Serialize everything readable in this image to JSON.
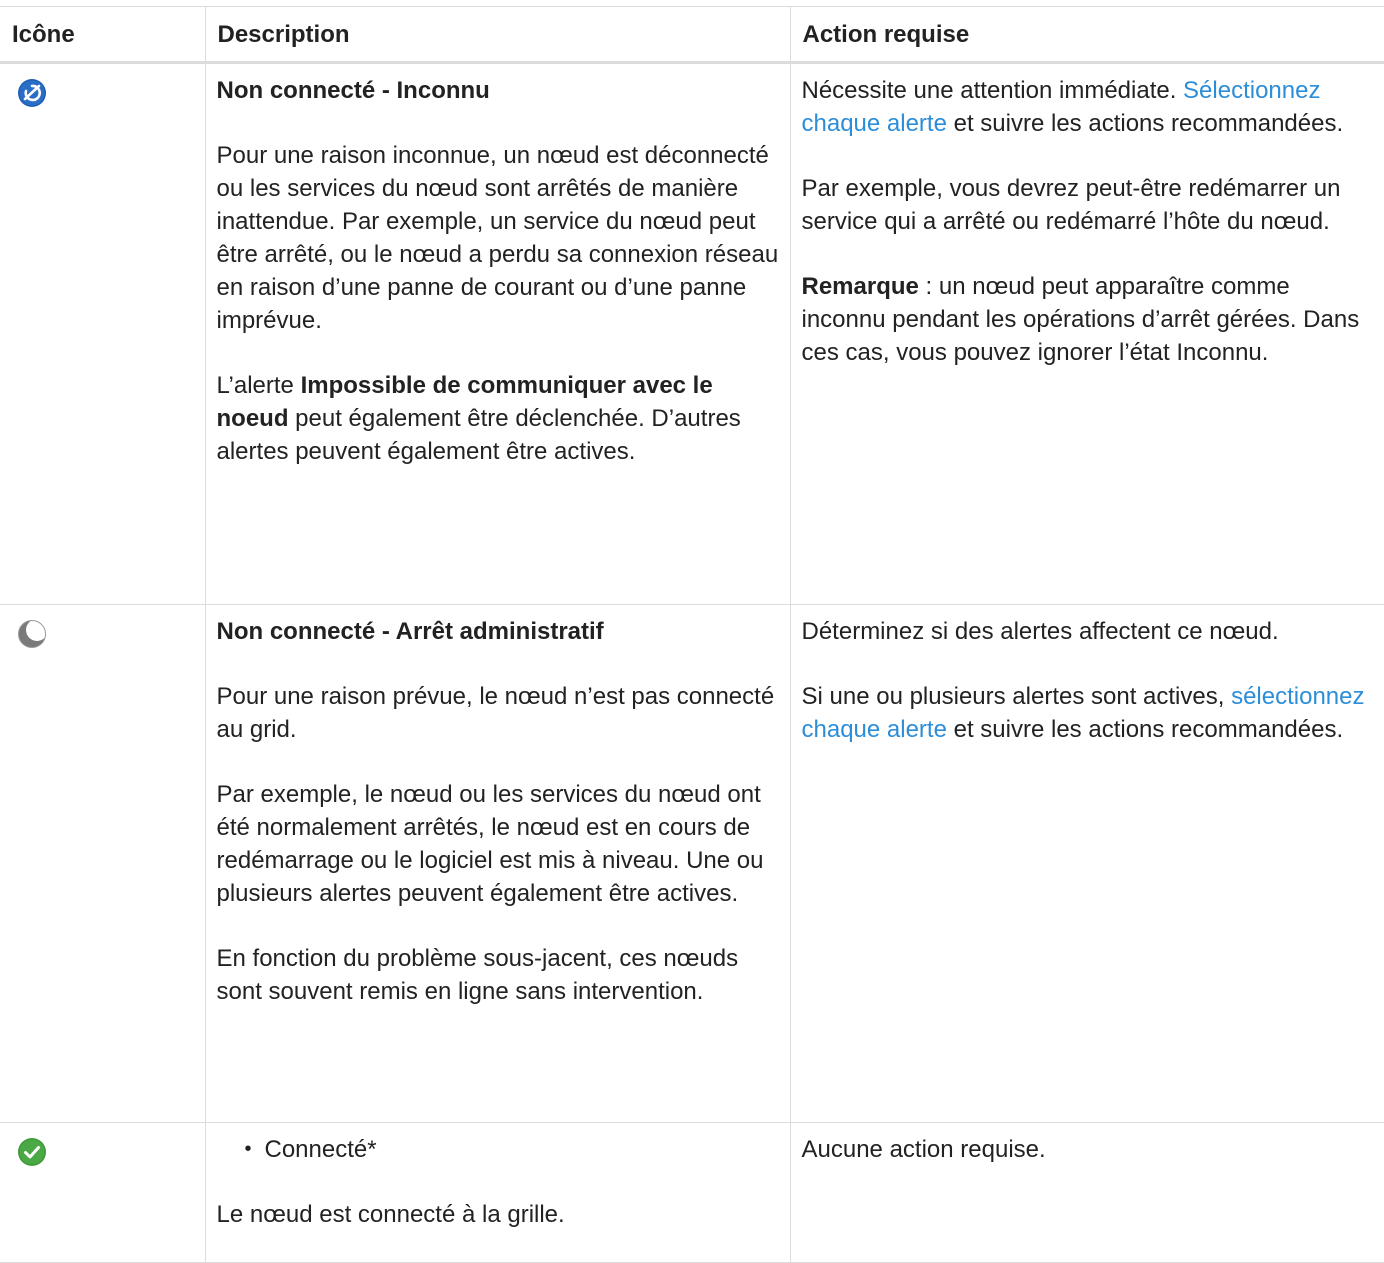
{
  "headers": {
    "icon": "Icône",
    "description": "Description",
    "action": "Action requise"
  },
  "rows": [
    {
      "icon": "unknown-status-icon",
      "title": "Non connecté - Inconnu",
      "desc_p1": "Pour une raison inconnue, un nœud est déconnecté ou les services du nœud sont arrêtés de manière inattendue. Par exemple, un service du nœud peut être arrêté, ou le nœud a perdu sa connexion réseau en raison d’une panne de courant ou d’une panne imprévue.",
      "desc_p2_pre": "L’alerte ",
      "desc_p2_bold": "Impossible de communiquer avec le noeud",
      "desc_p2_post": " peut également être déclenchée. D’autres alertes peuvent également être actives.",
      "action_p1_pre": "Nécessite une attention immédiate. ",
      "action_p1_link": "Sélectionnez chaque alerte",
      "action_p1_post": " et suivre les actions recommandées.",
      "action_p2": "Par exemple, vous devrez peut-être redémarrer un service qui a arrêté ou redémarré l’hôte du nœud.",
      "action_p3_bold": "Remarque",
      "action_p3_post": " : un nœud peut apparaître comme inconnu pendant les opérations d’arrêt gérées. Dans ces cas, vous pouvez ignorer l’état Inconnu."
    },
    {
      "icon": "moon-icon",
      "title": "Non connecté - Arrêt administratif",
      "desc_p1": "Pour une raison prévue, le nœud n’est pas connecté au grid.",
      "desc_p2": "Par exemple, le nœud ou les services du nœud ont été normalement arrêtés, le nœud est en cours de redémarrage ou le logiciel est mis à niveau. Une ou plusieurs alertes peuvent également être actives.",
      "desc_p3": "En fonction du problème sous-jacent, ces nœuds sont souvent remis en ligne sans intervention.",
      "action_p1": "Déterminez si des alertes affectent ce nœud.",
      "action_p2_pre": "Si une ou plusieurs alertes sont actives, ",
      "action_p2_link": "sélectionnez chaque alerte",
      "action_p2_post": " et suivre les actions recommandées."
    },
    {
      "icon": "check-circle-icon",
      "bullet": "Connecté*",
      "desc_p1": "Le nœud est connecté à la grille.",
      "action_p1": "Aucune action requise."
    }
  ]
}
